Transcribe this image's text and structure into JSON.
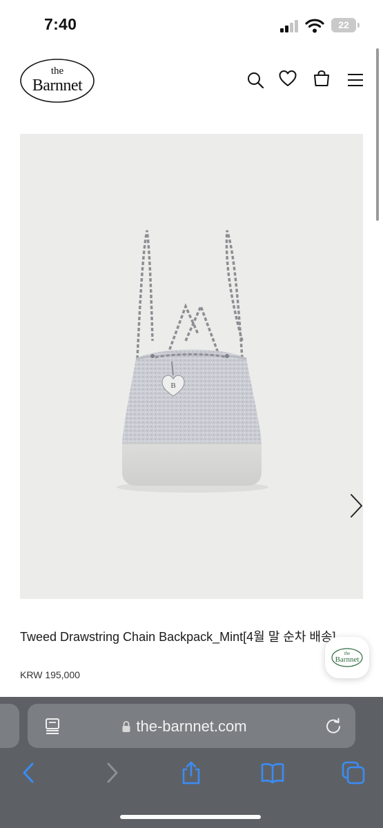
{
  "status_bar": {
    "time": "7:40",
    "battery": "22"
  },
  "brand": {
    "logo_line1": "the",
    "logo_line2": "Barnnet"
  },
  "header_icons": [
    "search-icon",
    "heart-icon",
    "bag-icon",
    "menu-icon"
  ],
  "product": {
    "title": "Tweed Drawstring Chain Backpack_Mint[4월 말 순차 배송]",
    "price": "KRW 195,000",
    "charm_letter": "B"
  },
  "chat_badge": {
    "line1": "the",
    "line2": "Barnnet"
  },
  "browser": {
    "url": "the-barnnet.com"
  },
  "colors": {
    "gallery_bg": "#ececea",
    "chrome_bg": "#5d6166",
    "urlbar_bg": "#7b7f84"
  }
}
